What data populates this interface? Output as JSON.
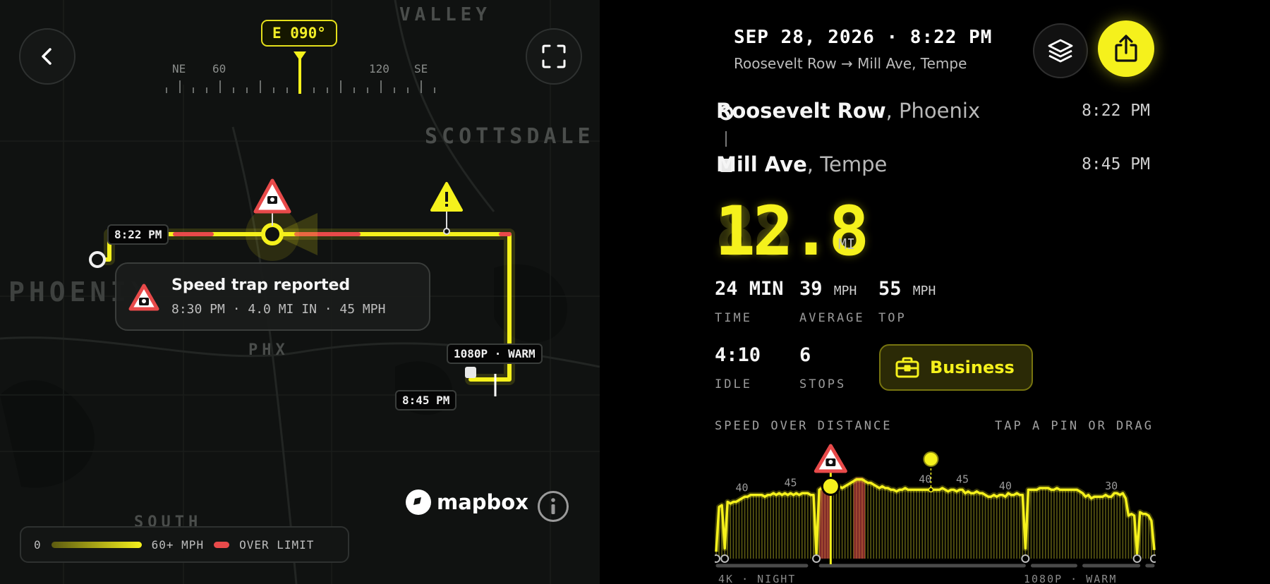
{
  "map": {
    "cities": [
      "VALLEY",
      "SCOTTSDALE",
      "PHOENIX",
      "PHX",
      "SOUTH"
    ],
    "heading_badge": "E 090°",
    "compass_ticks": [
      "NE",
      "60",
      "120",
      "SE"
    ],
    "start_time": "8:22 PM",
    "end_time": "8:45 PM",
    "segment_tag": "1080P · WARM",
    "speed_trap": {
      "title": "Speed trap reported",
      "details": "8:30 PM · 4.0 MI IN · 45 MPH"
    },
    "attribution": "mapbox",
    "legend": {
      "min": "0",
      "max": "60+ MPH",
      "over": "OVER LIMIT"
    },
    "colors": {
      "route": "#f5f11c",
      "over_limit": "#e84a4a",
      "background": "#101211"
    }
  },
  "trip": {
    "date": "SEP 28, 2026 · 8:22 PM",
    "route": "Roosevelt Row → Mill Ave, Tempe",
    "origin": {
      "name": "Roosevelt Row",
      "city": ", Phoenix",
      "time": "8:22 PM"
    },
    "destination": {
      "name": "Mill Ave",
      "city": ", Tempe",
      "time": "8:45 PM"
    },
    "distance": "12.8",
    "distance_ghost": "88.8",
    "distance_unit": "MI",
    "stats": {
      "time": {
        "value": "24 MIN",
        "label": "TIME"
      },
      "average": {
        "value": "39",
        "unit": "MPH",
        "label": "AVERAGE"
      },
      "top": {
        "value": "55",
        "unit": "MPH",
        "label": "TOP"
      },
      "idle": {
        "value": "4:10",
        "label": "IDLE"
      },
      "stops": {
        "value": "6",
        "label": "STOPS"
      }
    },
    "category_button": "Business",
    "chart_header": "SPEED OVER DISTANCE",
    "chart_hint": "TAP A PIN OR DRAG",
    "segment_start": "4K · NIGHT",
    "segment_end": "1080P · WARM",
    "accent": "#f5f11c"
  },
  "chart_data": {
    "type": "area",
    "title": "SPEED OVER DISTANCE",
    "xlabel": "",
    "ylabel": "",
    "speed_limit_labels": [
      "40",
      "45",
      "40",
      "45",
      "40",
      "30"
    ],
    "series": [
      {
        "values": [
          4,
          30,
          31,
          6,
          33,
          32,
          33,
          33,
          34,
          35,
          36,
          36,
          37,
          37,
          37,
          37,
          37,
          36,
          37,
          37,
          38,
          37,
          38,
          37,
          38,
          37,
          38,
          37,
          38,
          37,
          38,
          38,
          38,
          37,
          37,
          3,
          40,
          41,
          42,
          41,
          42,
          42,
          41,
          42,
          41,
          42,
          43,
          44,
          45,
          46,
          46,
          46,
          45,
          44,
          44,
          43,
          42,
          41,
          42,
          41,
          41,
          40,
          40,
          39,
          40,
          40,
          41,
          40,
          40,
          40,
          40,
          40,
          40,
          40,
          40,
          40,
          40,
          40,
          40,
          41,
          40,
          39,
          40,
          40,
          39,
          40,
          40,
          38,
          39,
          38,
          38,
          39,
          38,
          38,
          37,
          36,
          36,
          37,
          36,
          37,
          37,
          36,
          38,
          37,
          37,
          38,
          37,
          37,
          6,
          40,
          40,
          40,
          40,
          41,
          41,
          41,
          41,
          40,
          40,
          41,
          40,
          40,
          40,
          40,
          40,
          40,
          40,
          39,
          38,
          36,
          37,
          35,
          36,
          36,
          36,
          36,
          37,
          36,
          36,
          38,
          38,
          37,
          38,
          35,
          25,
          26,
          25,
          3,
          27,
          26,
          26,
          25,
          22,
          5
        ]
      }
    ],
    "markers": {
      "speed_trap_index": 40,
      "pin_index": 75
    }
  }
}
